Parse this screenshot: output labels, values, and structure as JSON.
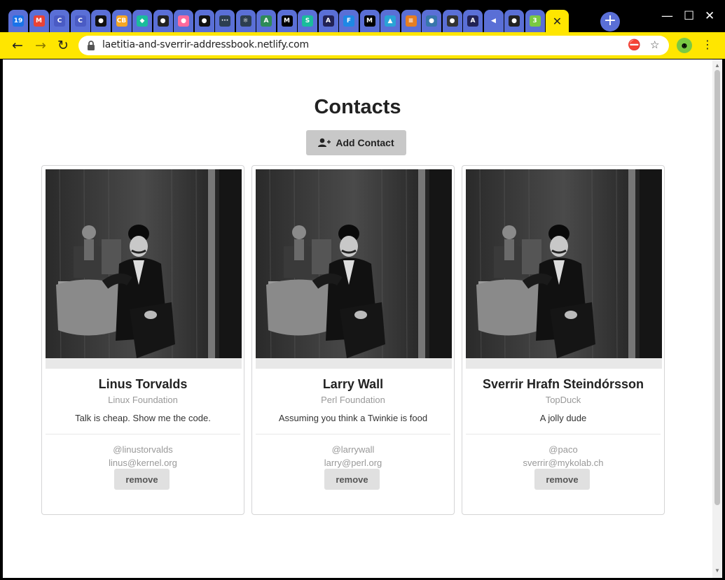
{
  "browser": {
    "url": "laetitia-and-sverrir-addressbook.netlify.com",
    "tab_favicons": [
      {
        "icon": "calendar-icon",
        "text": "19",
        "color": "#1a73e8"
      },
      {
        "icon": "gmail-icon",
        "text": "M",
        "color": "#ea4335"
      },
      {
        "icon": "doc-icon",
        "text": "C",
        "color": "#4a5bc4"
      },
      {
        "icon": "doc-icon",
        "text": "C",
        "color": "#4a5bc4"
      },
      {
        "icon": "github-icon",
        "text": "●",
        "color": "#111111"
      },
      {
        "icon": "codebox-icon",
        "text": "CB",
        "color": "#f5a623"
      },
      {
        "icon": "diamond-icon",
        "text": "◆",
        "color": "#1abc9c"
      },
      {
        "icon": "globe-icon",
        "text": "●",
        "color": "#222222"
      },
      {
        "icon": "app-icon",
        "text": "●",
        "color": "#ff6b9d"
      },
      {
        "icon": "github-icon",
        "text": "●",
        "color": "#111111"
      },
      {
        "icon": "dots-icon",
        "text": "···",
        "color": "#2c3e50"
      },
      {
        "icon": "react-icon",
        "text": "⚛",
        "color": "#2c3e50"
      },
      {
        "icon": "code-icon",
        "text": "A",
        "color": "#2e8b57"
      },
      {
        "icon": "medium-icon",
        "text": "M",
        "color": "#000000"
      },
      {
        "icon": "s-icon",
        "text": "S",
        "color": "#1abc9c"
      },
      {
        "icon": "code-icon",
        "text": "A",
        "color": "#222255"
      },
      {
        "icon": "f-icon",
        "text": "F",
        "color": "#1e88e5"
      },
      {
        "icon": "medium-icon",
        "text": "M",
        "color": "#000000"
      },
      {
        "icon": "bird-icon",
        "text": "▲",
        "color": "#29a3d6"
      },
      {
        "icon": "bars-icon",
        "text": "≡",
        "color": "#e67e22"
      },
      {
        "icon": "python-icon",
        "text": "●",
        "color": "#3776ab"
      },
      {
        "icon": "person-icon",
        "text": "●",
        "color": "#333333"
      },
      {
        "icon": "code-icon",
        "text": "A",
        "color": "#222255"
      },
      {
        "icon": "speaker-icon",
        "text": "◀",
        "color": "#5a6fd6"
      },
      {
        "icon": "globe-icon",
        "text": "●",
        "color": "#222222"
      },
      {
        "icon": "chart-icon",
        "text": "3",
        "color": "#7ac943"
      }
    ],
    "active_tab_close": "✕"
  },
  "page": {
    "title": "Contacts",
    "add_button_label": "Add Contact"
  },
  "contacts": [
    {
      "name": "Linus Torvalds",
      "organization": "Linux Foundation",
      "quote": "Talk is cheap. Show me the code.",
      "handle": "@linustorvalds",
      "email": "linus@kernel.org",
      "remove_label": "remove"
    },
    {
      "name": "Larry Wall",
      "organization": "Perl Foundation",
      "quote": "Assuming you think a Twinkie is food",
      "handle": "@larrywall",
      "email": "larry@perl.org",
      "remove_label": "remove"
    },
    {
      "name": "Sverrir Hrafn Steindórsson",
      "organization": "TopDuck",
      "quote": "A jolly dude",
      "handle": "@paco",
      "email": "sverrir@mykolab.ch",
      "remove_label": "remove"
    }
  ]
}
